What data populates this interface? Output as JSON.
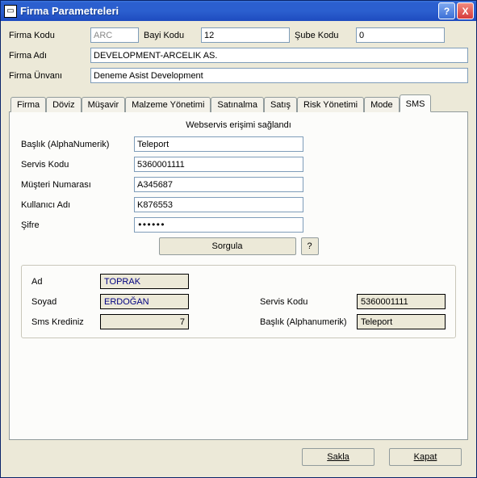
{
  "title": "Firma Parametreleri",
  "titlebar": {
    "help": "?",
    "close": "X"
  },
  "labels": {
    "firmaKodu": "Firma Kodu",
    "bayiKodu": "Bayi Kodu",
    "subeKodu": "Şube Kodu",
    "firmaAdi": "Firma Adı",
    "firmaUnvani": "Firma Ünvanı"
  },
  "header": {
    "firmaKodu": "ARC",
    "bayiKodu": "12",
    "subeKodu": "0",
    "firmaAdi": "DEVELOPMENT-ARCELIK AS.",
    "firmaUnvani": "Deneme Asist Development"
  },
  "tabs": [
    {
      "label": "Firma"
    },
    {
      "label": "Döviz"
    },
    {
      "label": "Müşavir"
    },
    {
      "label": "Malzeme Yönetimi"
    },
    {
      "label": "Satınalma"
    },
    {
      "label": "Satış"
    },
    {
      "label": "Risk Yönetimi"
    },
    {
      "label": "Mode"
    },
    {
      "label": "SMS"
    }
  ],
  "sms": {
    "status": "Webservis erişimi sağlandı",
    "labels": {
      "baslik": "Başlık (AlphaNumerik)",
      "servisKodu": "Servis Kodu",
      "musteriNo": "Müşteri Numarası",
      "kullanici": "Kullanıcı Adı",
      "sifre": "Şifre",
      "sorgula": "Sorgula",
      "helpBtn": "?"
    },
    "baslik": "Teleport",
    "servisKodu": "5360001111",
    "musteriNo": "A345687",
    "kullanici": "K876553",
    "sifre": "●●●●●●",
    "result": {
      "labels": {
        "ad": "Ad",
        "soyad": "Soyad",
        "smsKredi": "Sms Krediniz",
        "servisKodu": "Servis Kodu",
        "baslik": "Başlık (Alphanumerik)"
      },
      "ad": "TOPRAK",
      "soyad": "ERDOĞAN",
      "smsKredi": "7",
      "servisKodu": "5360001111",
      "baslik": "Teleport"
    }
  },
  "footer": {
    "sakla": "Sakla",
    "kapat": "Kapat"
  }
}
